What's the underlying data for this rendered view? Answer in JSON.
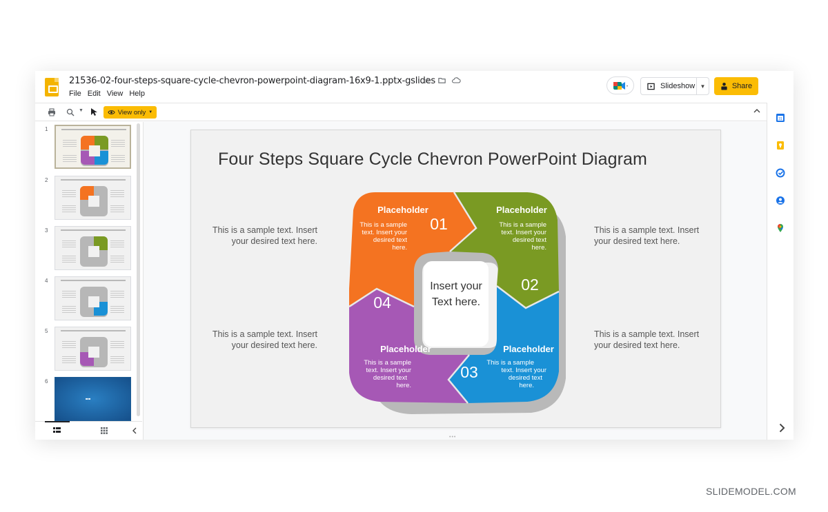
{
  "header": {
    "doc_title": "21536-02-four-steps-square-cycle-chevron-powerpoint-diagram-16x9-1.pptx-gslides",
    "menu": [
      "File",
      "Edit",
      "View",
      "Help"
    ],
    "slideshow_label": "Slideshow",
    "share_label": "Share"
  },
  "toolbar": {
    "view_only_label": "View only"
  },
  "slides": {
    "numbers": [
      "1",
      "2",
      "3",
      "4",
      "5",
      "6"
    ]
  },
  "slide": {
    "title": "Four Steps Square Cycle Chevron PowerPoint Diagram",
    "left_top_text": "This is a sample text. Insert your desired text here.",
    "left_bottom_text": "This is a sample text. Insert your desired text here.",
    "right_top_text": "This is a sample text. Insert your desired text here.",
    "right_bottom_text": "This is a sample text. Insert your desired text here.",
    "center_line1": "Insert your",
    "center_line2": "Text here.",
    "steps": [
      {
        "number": "01",
        "title": "Placeholder",
        "lines": [
          "This is a sample",
          "text. Insert your",
          "desired text",
          "here."
        ],
        "color": "#f47321"
      },
      {
        "number": "02",
        "title": "Placeholder",
        "lines": [
          "This is a sample",
          "text. Insert your",
          "desired text",
          "here."
        ],
        "color": "#7a9a23"
      },
      {
        "number": "03",
        "title": "Placeholder",
        "lines": [
          "This is a sample",
          "text. Insert your",
          "desired text",
          "here."
        ],
        "color": "#1a91d6"
      },
      {
        "number": "04",
        "title": "Placeholder",
        "lines": [
          "This is a sample",
          "text. Insert your",
          "desired text",
          "here."
        ],
        "color": "#a658b5"
      }
    ],
    "ring_color": "#b9b9b9"
  },
  "watermark": "SLIDEMODEL.COM",
  "colors": {
    "accent_yellow": "#fbbc04",
    "orange": "#f47321",
    "green": "#7a9a23",
    "blue": "#1a91d6",
    "purple": "#a658b5"
  },
  "icons": {
    "header": [
      "slides-logo-icon",
      "star-icon",
      "move-to-folder-icon",
      "cloud-status-icon",
      "meet-icon",
      "present-icon",
      "lock-person-icon"
    ],
    "toolbar": [
      "print-icon",
      "zoom-icon",
      "select-cursor-icon",
      "eye-icon"
    ],
    "side": [
      "calendar-icon",
      "keep-icon",
      "tasks-icon",
      "contacts-icon",
      "maps-icon"
    ]
  }
}
